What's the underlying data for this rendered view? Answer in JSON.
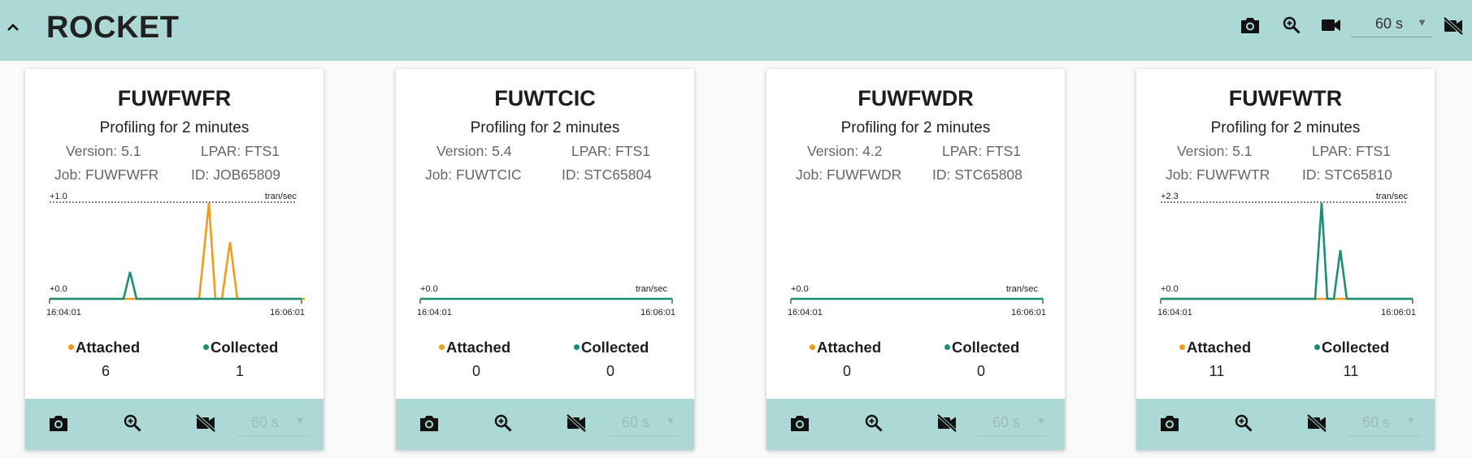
{
  "app": {
    "title": "ROCKET"
  },
  "header": {
    "interval": "60 s"
  },
  "colors": {
    "attached": "#f29b1a",
    "collected": "#1a8f76",
    "bar": "#acd9d5"
  },
  "cards": [
    {
      "title": "FUWFWFR",
      "subtitle": "Profiling for 2 minutes",
      "version": "Version: 5.1",
      "lpar": "LPAR: FTS1",
      "job": "Job: FUWFWFR",
      "id": "ID: JOB65809",
      "chart": {
        "max_label": "+1.0",
        "min_label": "+0.0",
        "unit": "tran/sec",
        "x_start": "16:04:01",
        "x_end": "16:06:01",
        "unit_on_top": true
      },
      "legend": {
        "attached": "Attached",
        "collected": "Collected"
      },
      "counts": {
        "attached": "6",
        "collected": "1"
      },
      "footer": {
        "interval": "60 s"
      }
    },
    {
      "title": "FUWTCIC",
      "subtitle": "Profiling for 2 minutes",
      "version": "Version: 5.4",
      "lpar": "LPAR: FTS1",
      "job": "Job: FUWTCIC",
      "id": "ID: STC65804",
      "chart": {
        "max_label": "",
        "min_label": "+0.0",
        "unit": "tran/sec",
        "x_start": "16:04:01",
        "x_end": "16:06:01",
        "unit_on_top": false
      },
      "legend": {
        "attached": "Attached",
        "collected": "Collected"
      },
      "counts": {
        "attached": "0",
        "collected": "0"
      },
      "footer": {
        "interval": "60 s"
      }
    },
    {
      "title": "FUWFWDR",
      "subtitle": "Profiling for 2 minutes",
      "version": "Version: 4.2",
      "lpar": "LPAR: FTS1",
      "job": "Job: FUWFWDR",
      "id": "ID: STC65808",
      "chart": {
        "max_label": "",
        "min_label": "+0.0",
        "unit": "tran/sec",
        "x_start": "16:04:01",
        "x_end": "16:06:01",
        "unit_on_top": false
      },
      "legend": {
        "attached": "Attached",
        "collected": "Collected"
      },
      "counts": {
        "attached": "0",
        "collected": "0"
      },
      "footer": {
        "interval": "60 s"
      }
    },
    {
      "title": "FUWFWTR",
      "subtitle": "Profiling for 2 minutes",
      "version": "Version: 5.1",
      "lpar": "LPAR: FTS1",
      "job": "Job: FUWFWTR",
      "id": "ID: STC65810",
      "chart": {
        "max_label": "+2.3",
        "min_label": "+0.0",
        "unit": "tran/sec",
        "x_start": "16:04:01",
        "x_end": "16:06:01",
        "unit_on_top": true
      },
      "legend": {
        "attached": "Attached",
        "collected": "Collected"
      },
      "counts": {
        "attached": "11",
        "collected": "11"
      },
      "footer": {
        "interval": "60 s"
      }
    }
  ]
}
